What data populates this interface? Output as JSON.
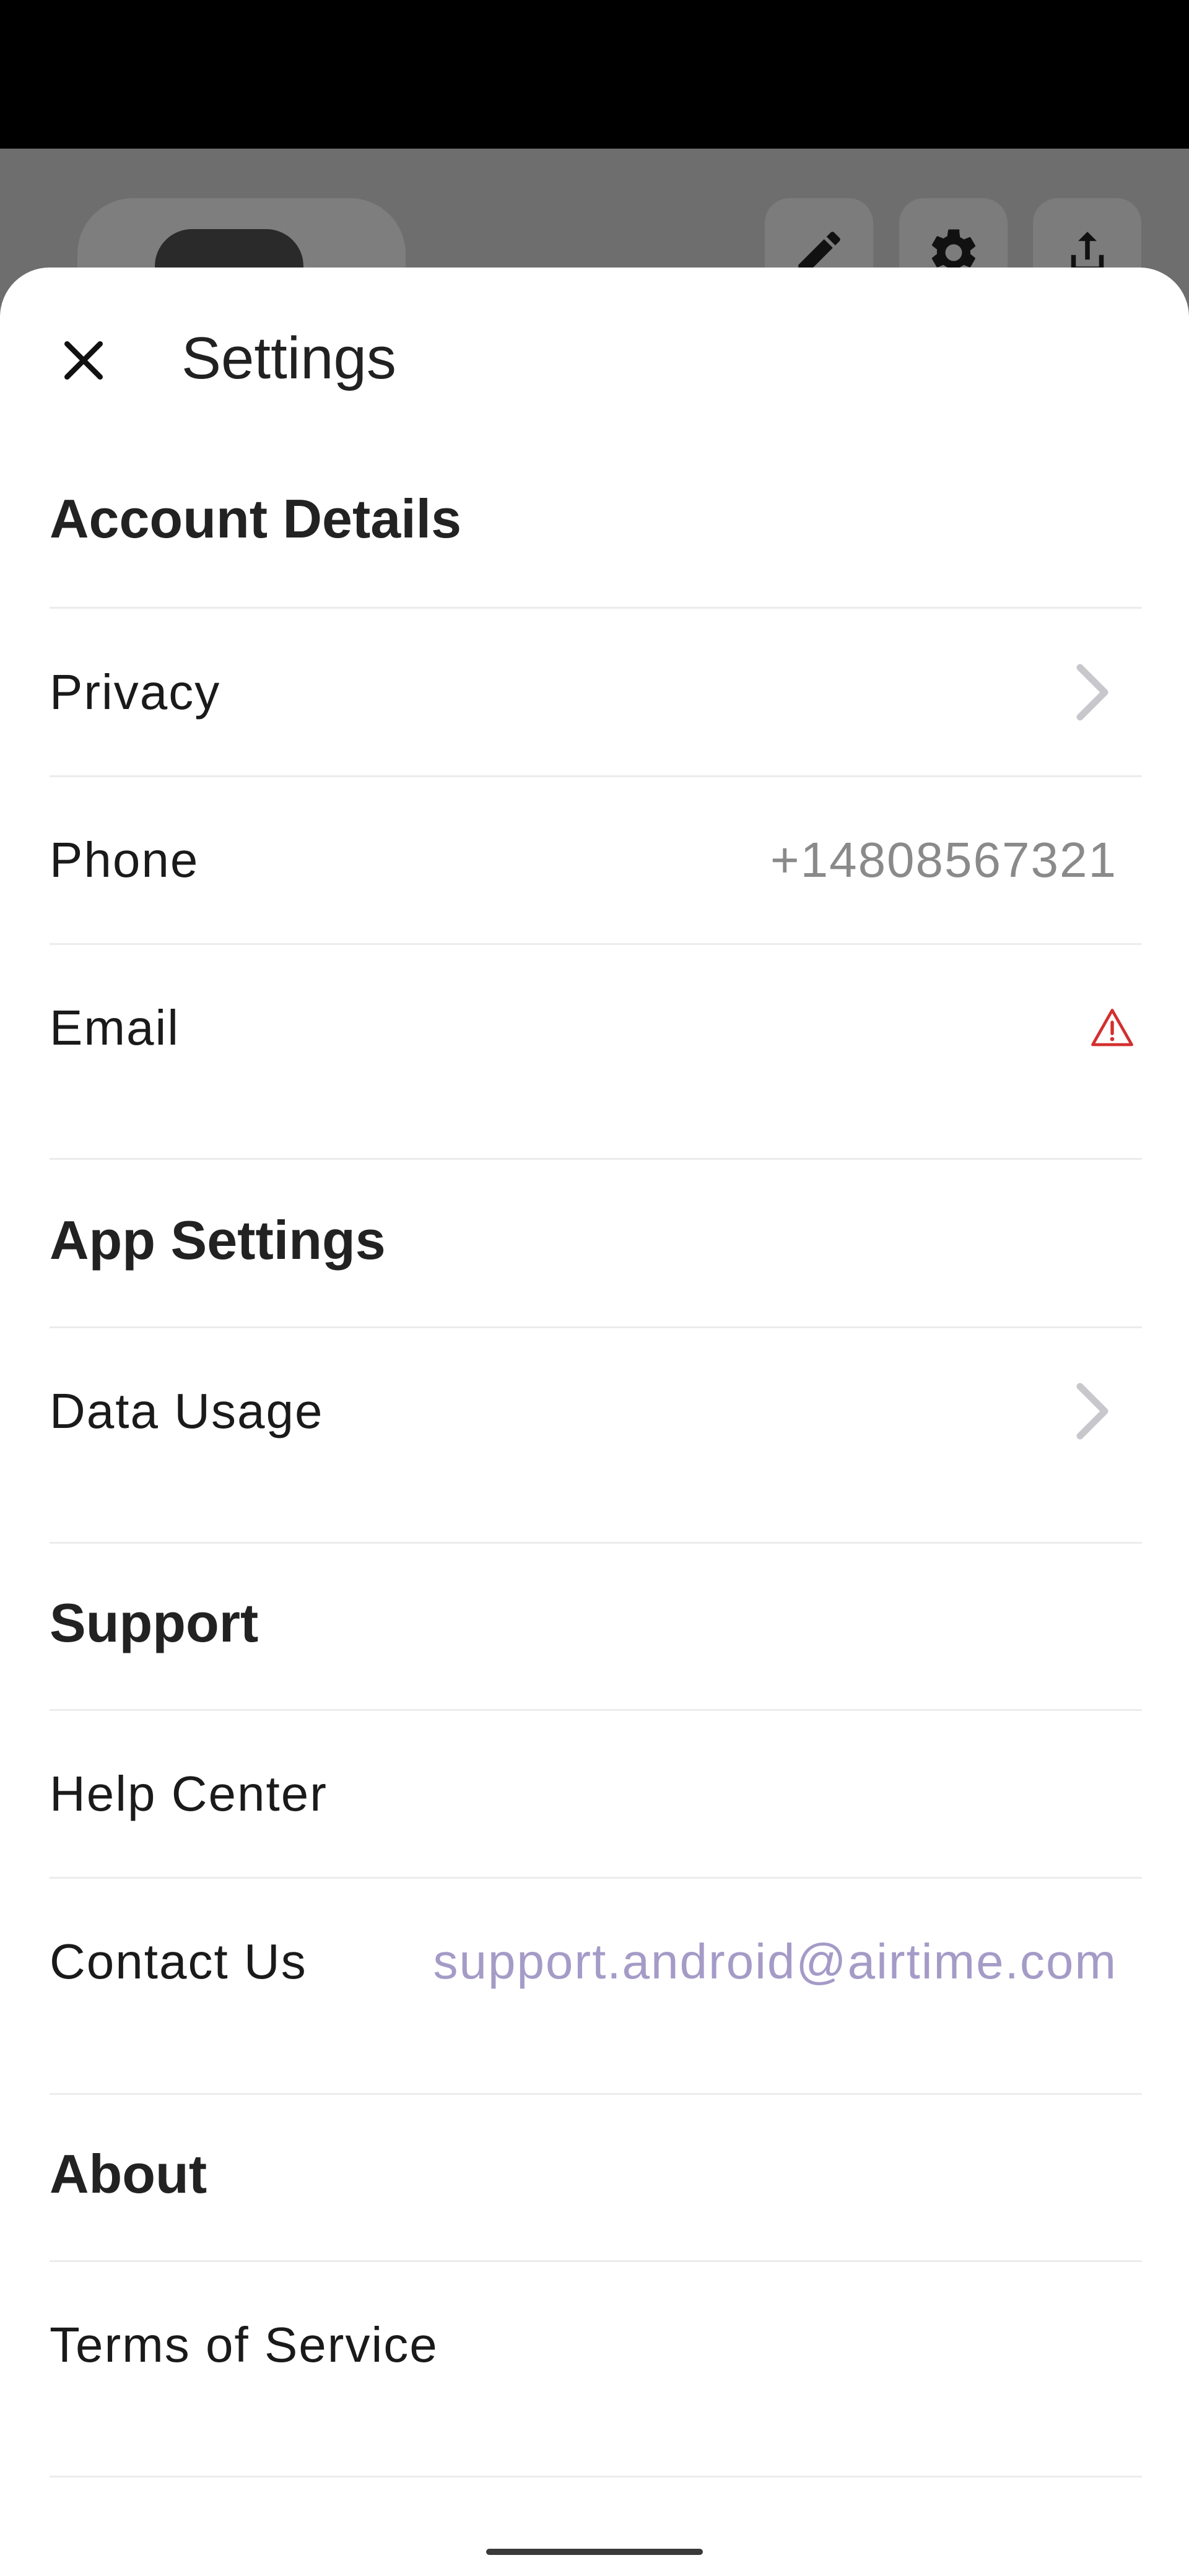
{
  "header": {
    "title": "Settings",
    "close_icon": "close-icon"
  },
  "sections": [
    {
      "title": "Account Details"
    },
    {
      "title": "App Settings"
    },
    {
      "title": "Support"
    },
    {
      "title": "About"
    }
  ],
  "rows": {
    "privacy": {
      "label": "Privacy",
      "icon": "chevron-right-icon"
    },
    "phone": {
      "label": "Phone",
      "value": "+14808567321"
    },
    "email": {
      "label": "Email",
      "icon": "warning-icon",
      "icon_color": "#d32f2f"
    },
    "data_usage": {
      "label": "Data Usage",
      "icon": "chevron-right-icon"
    },
    "help_center": {
      "label": "Help Center"
    },
    "contact_us": {
      "label": "Contact Us",
      "value": "support.android@airtime.com",
      "value_color": "#a59bc7"
    },
    "terms": {
      "label": "Terms of Service"
    }
  },
  "background": {
    "icons": [
      "pencil-icon",
      "gear-icon",
      "share-icon"
    ]
  }
}
